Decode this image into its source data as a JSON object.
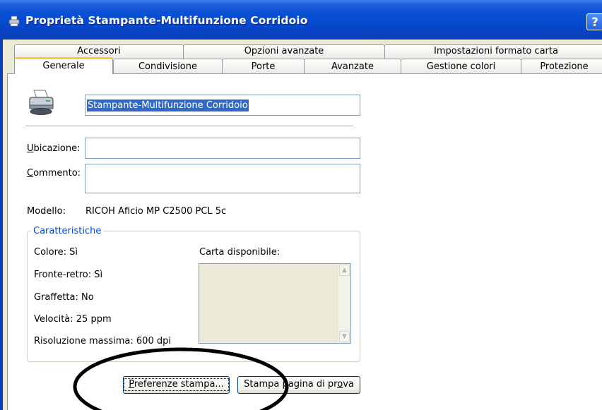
{
  "window": {
    "title": "Proprietà Stampante-Multifunzione Corridoio",
    "help_label": "?"
  },
  "tabs": {
    "row1": [
      {
        "label": "Accessori"
      },
      {
        "label": "Opzioni avanzate"
      },
      {
        "label": "Impostazioni formato carta"
      }
    ],
    "row2": [
      {
        "label": "Generale",
        "active": true
      },
      {
        "label": "Condivisione"
      },
      {
        "label": "Porte"
      },
      {
        "label": "Avanzate"
      },
      {
        "label": "Gestione colori"
      },
      {
        "label": "Protezione"
      }
    ]
  },
  "general": {
    "printer_name": "Stampante-Multifunzione Corridoio",
    "location_label_accel": "U",
    "location_label_rest": "bicazione:",
    "location_value": "",
    "comment_label_accel": "C",
    "comment_label_rest": "ommento:",
    "comment_value": "",
    "model_label": "Modello:",
    "model_value": "RICOH Aficio MP C2500 PCL 5c"
  },
  "features": {
    "legend": "Caratteristiche",
    "color": "Colore: Sì",
    "duplex": "Fronte-retro: Sì",
    "staple": "Graffetta: No",
    "speed": "Velocità: 25 ppm",
    "max_resolution": "Risoluzione massima: 600 dpi",
    "paper_available_label": "Carta disponibile:",
    "paper_available_items": []
  },
  "buttons": {
    "preferences_accel": "P",
    "preferences_rest": "referenze stampa...",
    "test_page_before": "Stampa p",
    "test_page_mid": "a",
    "test_page_after": "gina di pr",
    "test_page_accel": "o",
    "test_page_end": "va"
  },
  "colors": {
    "titlebar": "#0545c9",
    "selection": "#316ac5",
    "group_legend": "#0046d5",
    "active_tab_highlight": "#ffc83c",
    "annotation": "#000000"
  },
  "icons": {
    "title": "printer-icon",
    "printer": "printer-icon",
    "scroll_up": "chevron-up-icon",
    "scroll_down": "chevron-down-icon"
  }
}
